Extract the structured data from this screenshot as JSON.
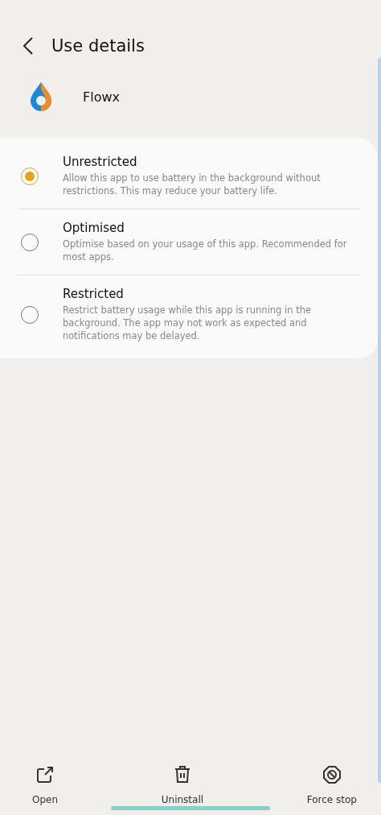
{
  "header": {
    "title": "Use details"
  },
  "app": {
    "name": "Flowx"
  },
  "options": [
    {
      "label": "Unrestricted",
      "description": "Allow this app to use battery in the background without restrictions. This may reduce your battery life.",
      "selected": true
    },
    {
      "label": "Optimised",
      "description": "Optimise based on your usage of this app. Recommended for most apps.",
      "selected": false
    },
    {
      "label": "Restricted",
      "description": "Restrict battery usage while this app is running in the background. The app may not work as expected and notifications may be delayed.",
      "selected": false
    }
  ],
  "actions": [
    {
      "kind": "open",
      "label": "Open"
    },
    {
      "kind": "uninstall",
      "label": "Uninstall"
    },
    {
      "kind": "stop",
      "label": "Force stop"
    }
  ]
}
